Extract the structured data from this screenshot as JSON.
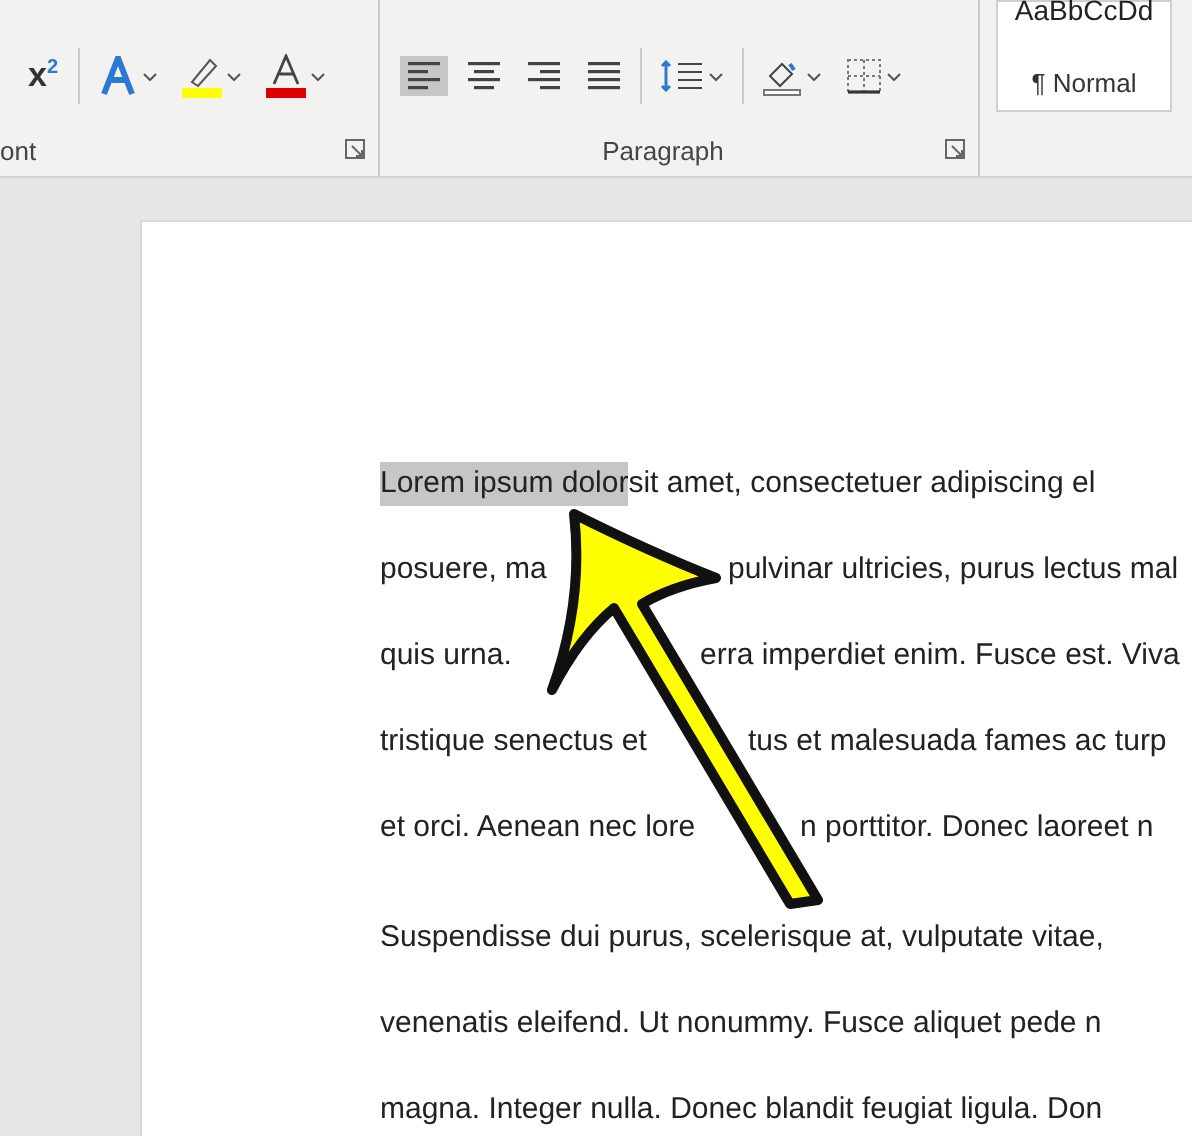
{
  "ribbon": {
    "font_group": {
      "superscript": "x$^{2}$",
      "highlight": {
        "color": "#ffff00"
      },
      "font_colour": {
        "color": "#e00000"
      },
      "label": "ont"
    },
    "paragraph_group": {
      "alignments": [
        {
          "kind": "left",
          "selected": true
        },
        {
          "kind": "center",
          "selected": false
        },
        {
          "kind": "right",
          "selected": false
        },
        {
          "kind": "justify",
          "selected": false
        }
      ],
      "label": "Paragraph"
    },
    "styles": {
      "preview": "AaBbCcDd",
      "name": "¶ Normal"
    }
  },
  "document": {
    "paragraphs": [
      {
        "lines": [
          {
            "segments": [
              {
                "text": "Lorem ipsum dolor",
                "highlighted": true
              },
              {
                "text": " sit amet, consectetuer adipiscing el",
                "highlighted": false
              }
            ]
          },
          {
            "segments": [
              {
                "text": "posuere, ma",
                "highlighted": false
              },
              {
                "text": "pulvinar ultricies, purus lectus mal",
                "highlighted": false
              }
            ]
          },
          {
            "segments": [
              {
                "text": "quis urna.",
                "highlighted": false
              },
              {
                "text": "erra imperdiet enim. Fusce est. Viva",
                "highlighted": false
              }
            ]
          },
          {
            "segments": [
              {
                "text": "tristique senectus et",
                "highlighted": false
              },
              {
                "text": "tus et malesuada fames ac turp",
                "highlighted": false
              }
            ]
          },
          {
            "segments": [
              {
                "text": "et orci. Aenean nec lore",
                "highlighted": false
              },
              {
                "text": "n porttitor. Donec laoreet n",
                "highlighted": false
              }
            ]
          }
        ]
      },
      {
        "lines": [
          {
            "segments": [
              {
                "text": "Suspendisse dui purus, scelerisque at, vulputate vitae,",
                "highlighted": false
              }
            ]
          },
          {
            "segments": [
              {
                "text": "venenatis eleifend. Ut nonummy. Fusce aliquet pede n",
                "highlighted": false
              }
            ]
          },
          {
            "segments": [
              {
                "text": "magna. Integer nulla. Donec blandit feugiat ligula. Don",
                "highlighted": false
              }
            ]
          }
        ]
      }
    ]
  }
}
